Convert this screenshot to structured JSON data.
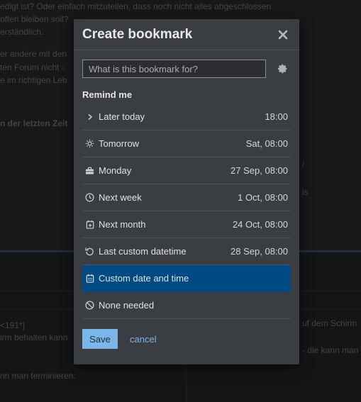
{
  "background": {
    "lines": [
      "edigt ist? Oder einfach mitzuteilen, dass noch nicht alles abgeschlossen",
      "offen bleiben soll?",
      "erständlich.",
      "er andere mit den",
      "ten Forum nicht -",
      "e im richtigen Leb",
      "n der letzten Zeit"
    ],
    "right_lines": [
      "/",
      "is"
    ],
    "editor_lines": [
      "<191*]",
      "irm behalten kann",
      "nn man terminieren."
    ],
    "editor_right_lines": [
      "uf dem Schirm",
      "- die kann man"
    ]
  },
  "modal": {
    "title": "Create bookmark",
    "close_icon": "close-icon",
    "name_placeholder": "What is this bookmark for?",
    "settings_icon": "gear-icon",
    "remind_label": "Remind me",
    "options": [
      {
        "icon": "chevron-right-icon",
        "label": "Later today",
        "value": "18:00",
        "selected": false
      },
      {
        "icon": "sun-icon",
        "label": "Tomorrow",
        "value": "Sat, 08:00",
        "selected": false
      },
      {
        "icon": "briefcase-icon",
        "label": "Monday",
        "value": "27 Sep, 08:00",
        "selected": false
      },
      {
        "icon": "clock-icon",
        "label": "Next week",
        "value": "1 Oct, 08:00",
        "selected": false
      },
      {
        "icon": "calendar-plus-icon",
        "label": "Next month",
        "value": "24 Oct, 08:00",
        "selected": false
      },
      {
        "icon": "undo-icon",
        "label": "Last custom datetime",
        "value": "28 Sep, 08:00",
        "selected": false
      },
      {
        "icon": "calendar-icon",
        "label": "Custom date and time",
        "value": "",
        "selected": true
      },
      {
        "icon": "ban-icon",
        "label": "None needed",
        "value": "",
        "selected": false
      }
    ],
    "save_label": "Save",
    "cancel_label": "cancel"
  },
  "colors": {
    "modal_bg": "#3a3d41",
    "selected_bg": "#004a84",
    "accent": "#7bb6e9"
  }
}
